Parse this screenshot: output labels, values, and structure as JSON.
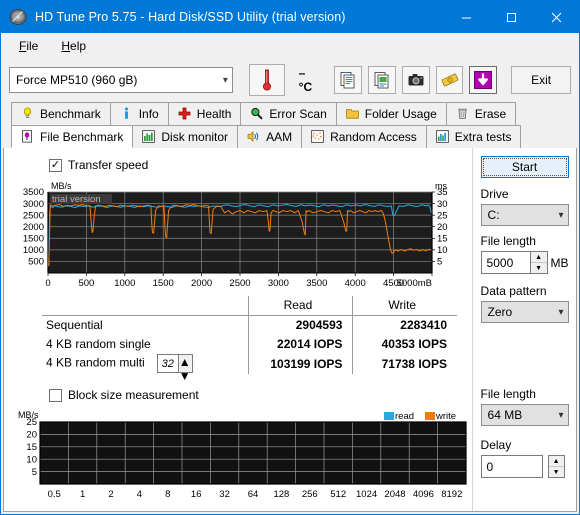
{
  "window": {
    "title": "HD Tune Pro 5.75 - Hard Disk/SSD Utility (trial version)",
    "icon": "hdtune-logo-icon",
    "minimize": "–",
    "maximize": "☐",
    "close": "✕",
    "accent": "#0078d7"
  },
  "menu": {
    "items": [
      "File",
      "Help"
    ]
  },
  "toolbar": {
    "drive": "Force MP510 (960 gB)",
    "temperature": "– °C",
    "buttons": [
      {
        "name": "copy-text-icon",
        "title": "Copy text"
      },
      {
        "name": "copy-image-icon",
        "title": "Copy image"
      },
      {
        "name": "screenshot-icon",
        "title": "Screenshot"
      },
      {
        "name": "money-icon",
        "title": "Buy"
      },
      {
        "name": "download-update-icon",
        "title": "Update"
      }
    ],
    "exit_label": "Exit"
  },
  "tabs": {
    "row1": [
      {
        "label": "Benchmark",
        "icon": "lightbulb-icon",
        "active": false
      },
      {
        "label": "Info",
        "icon": "info-icon",
        "active": false
      },
      {
        "label": "Health",
        "icon": "red-cross-icon",
        "active": false
      },
      {
        "label": "Error Scan",
        "icon": "magnifier-icon",
        "active": false
      },
      {
        "label": "Folder Usage",
        "icon": "folder-icon",
        "active": false
      },
      {
        "label": "Erase",
        "icon": "trash-icon",
        "active": false
      }
    ],
    "row2": [
      {
        "label": "File Benchmark",
        "icon": "file-benchmark-icon",
        "active": true
      },
      {
        "label": "Disk monitor",
        "icon": "bar-chart-icon",
        "active": false
      },
      {
        "label": "AAM",
        "icon": "speaker-icon",
        "active": false
      },
      {
        "label": "Random Access",
        "icon": "dots-icon",
        "active": false
      },
      {
        "label": "Extra tests",
        "icon": "chart-icon",
        "active": false
      }
    ]
  },
  "transfer_section": {
    "checkbox_label": "Transfer speed",
    "checked": true,
    "watermark": "trial version"
  },
  "results": {
    "headers": [
      "",
      "Read",
      "Write"
    ],
    "rows": [
      {
        "label": "Sequential",
        "read": "2904593",
        "write": "2283410"
      },
      {
        "label": "4 KB random single",
        "read": "22014 IOPS",
        "write": "40353 IOPS"
      },
      {
        "label": "4 KB random multi",
        "read": "103199 IOPS",
        "write": "71738 IOPS",
        "queue_depth": "32"
      }
    ]
  },
  "block_section": {
    "checkbox_label": "Block size measurement",
    "checked": false,
    "legend": [
      {
        "label": "read",
        "color": "#29a8e0"
      },
      {
        "label": "write",
        "color": "#ee7d10"
      }
    ]
  },
  "right_panel": {
    "start_label": "Start",
    "drive_label": "Drive",
    "drive_value": "C:",
    "file_length_label": "File length",
    "file_length_value": "5000",
    "file_length_unit": "MB",
    "data_pattern_label": "Data pattern",
    "data_pattern_value": "Zero",
    "block_file_length_label": "File length",
    "block_file_length_value": "64 MB",
    "delay_label": "Delay",
    "delay_value": "0"
  },
  "chart_data": [
    {
      "type": "line",
      "id": "transfer-speed-chart",
      "title": "Transfer speed",
      "ylabel": "MB/s",
      "ylabel_right": "ms",
      "xlabel": "",
      "xunit": "mB",
      "xlim": [
        0,
        5000
      ],
      "ylim": [
        0,
        3500
      ],
      "ylim_right": [
        0,
        35
      ],
      "yticks": [
        500,
        1000,
        1500,
        2000,
        2500,
        3000,
        3500
      ],
      "yticks_right": [
        5,
        10,
        15,
        20,
        25,
        30,
        35
      ],
      "xticks": [
        0,
        500,
        1000,
        1500,
        2000,
        2500,
        3000,
        3500,
        4000,
        4500,
        5000
      ],
      "grid": true,
      "background": "#1d1d1d",
      "series": [
        {
          "name": "read",
          "color": "#29a8e0",
          "x": [
            10,
            20,
            30,
            40,
            60,
            90,
            130,
            180,
            230,
            290,
            350,
            410,
            470,
            530,
            590,
            650,
            710,
            770,
            830,
            890,
            950,
            1010,
            1070,
            1130,
            1190,
            1250,
            1310,
            1370,
            1430,
            1490,
            1550,
            1610,
            1670,
            1730,
            1790,
            1850,
            1910,
            1970,
            2030,
            2090,
            2150,
            2210,
            2270,
            2330,
            2390,
            2450,
            2510,
            2570,
            2630,
            2690,
            2750,
            2810,
            2870,
            2930,
            2990,
            3050,
            3110,
            3170,
            3230,
            3290,
            3350,
            3410,
            3470,
            3530,
            3590,
            3650,
            3710,
            3770,
            3830,
            3890,
            3950,
            4010,
            4070,
            4130,
            4190,
            4250,
            4310,
            4370,
            4430,
            4470,
            4490,
            4510,
            4570,
            4630,
            4690,
            4750,
            4810,
            4870,
            4930,
            4950,
            4970,
            4990
          ],
          "y": [
            300,
            2550,
            2900,
            2870,
            2820,
            2900,
            2870,
            2840,
            2900,
            2880,
            2830,
            2900,
            2870,
            2900,
            2840,
            2900,
            2880,
            2830,
            2900,
            2870,
            2840,
            2900,
            2880,
            2830,
            2900,
            2860,
            2900,
            2870,
            2840,
            2900,
            2880,
            2830,
            2900,
            2870,
            2840,
            2900,
            2880,
            2900,
            2850,
            2830,
            2900,
            2870,
            2900,
            2950,
            2900,
            2870,
            2920,
            2960,
            2900,
            2870,
            2950,
            2900,
            2870,
            2950,
            2900,
            2930,
            2960,
            2910,
            2880,
            2950,
            2900,
            2940,
            2900,
            2870,
            2950,
            2900,
            2940,
            2900,
            2870,
            2950,
            2900,
            2940,
            2900,
            2960,
            2910,
            2880,
            2950,
            2900,
            2880,
            2900,
            2500,
            2470,
            2900,
            2880,
            2950,
            2900,
            2870,
            2950,
            2900,
            2940,
            2880,
            2600
          ]
        },
        {
          "name": "write",
          "color": "#ee7d10",
          "x": [
            10,
            30,
            60,
            100,
            150,
            200,
            250,
            300,
            350,
            400,
            450,
            500,
            545,
            560,
            575,
            585,
            600,
            620,
            660,
            700,
            750,
            800,
            850,
            900,
            950,
            1000,
            1050,
            1100,
            1150,
            1200,
            1250,
            1300,
            1340,
            1350,
            1360,
            1375,
            1400,
            1440,
            1480,
            1510,
            1520,
            1530,
            1545,
            1570,
            1610,
            1650,
            1700,
            1750,
            1800,
            1850,
            1900,
            1950,
            2000,
            2050,
            2090,
            2100,
            2110,
            2125,
            2150,
            2200,
            2250,
            2300,
            2350,
            2400,
            2450,
            2500,
            2550,
            2600,
            2650,
            2700,
            2750,
            2800,
            2850,
            2870,
            2880,
            2890,
            2905,
            2930,
            2970,
            3010,
            3060,
            3110,
            3160,
            3210,
            3260,
            3310,
            3340,
            3350,
            3360,
            3375,
            3400,
            3450,
            3500,
            3550,
            3600,
            3650,
            3700,
            3750,
            3800,
            3850,
            3880,
            3890,
            3900,
            3915,
            3940,
            3980,
            4020,
            4060,
            4100,
            4140,
            4180,
            4220,
            4260,
            4300,
            4340,
            4360,
            4380,
            4400,
            4420,
            4440,
            4460,
            4480,
            4500,
            4520,
            4560,
            4600,
            4640,
            4680,
            4720,
            4760,
            4800,
            4840,
            4880,
            4920,
            4960,
            4990
          ],
          "y": [
            300,
            2950,
            2900,
            2930,
            2960,
            2880,
            2920,
            2900,
            2950,
            2920,
            2960,
            2900,
            2920,
            2300,
            1750,
            1780,
            2400,
            2900,
            2930,
            2900,
            2880,
            2930,
            2900,
            2870,
            2930,
            2900,
            2880,
            2930,
            2900,
            2870,
            2900,
            2930,
            2900,
            2200,
            1750,
            1720,
            2700,
            2900,
            2870,
            2900,
            2200,
            1600,
            1520,
            2700,
            2900,
            2930,
            2900,
            2880,
            2950,
            2920,
            2960,
            2900,
            2880,
            2930,
            2900,
            2300,
            1750,
            1700,
            2750,
            2900,
            2870,
            2600,
            2700,
            2550,
            2650,
            2700,
            2600,
            2700,
            2650,
            2600,
            2700,
            2650,
            2700,
            2200,
            1800,
            1850,
            2600,
            2700,
            2650,
            2600,
            2700,
            2650,
            2700,
            2600,
            2700,
            2200,
            1700,
            1650,
            2700,
            2650,
            2700,
            2600,
            2650,
            2700,
            2650,
            2600,
            2700,
            2650,
            2700,
            2200,
            1800,
            1820,
            2700,
            2650,
            2700,
            2600,
            2650,
            2700,
            2650,
            2600,
            2700,
            2650,
            2700,
            2650,
            2700,
            2600,
            2400,
            2100,
            1700,
            1350,
            1000,
            850,
            900,
            1000,
            950,
            1020,
            950,
            1000,
            1050,
            980,
            1020,
            950,
            1010,
            960,
            1030,
            990,
            1050,
            1000
          ]
        }
      ]
    },
    {
      "type": "line",
      "id": "block-size-chart",
      "title": "Block size measurement",
      "ylabel": "MB/s",
      "xlabel": "",
      "ylim": [
        0,
        25
      ],
      "yticks": [
        5,
        10,
        15,
        20,
        25
      ],
      "xticks": [
        "0.5",
        "1",
        "2",
        "4",
        "8",
        "16",
        "32",
        "64",
        "128",
        "256",
        "512",
        "1024",
        "2048",
        "4096",
        "8192"
      ],
      "grid": true,
      "background": "#111111",
      "series": [
        {
          "name": "read",
          "color": "#29a8e0",
          "x": [],
          "y": []
        },
        {
          "name": "write",
          "color": "#ee7d10",
          "x": [],
          "y": []
        }
      ]
    }
  ]
}
